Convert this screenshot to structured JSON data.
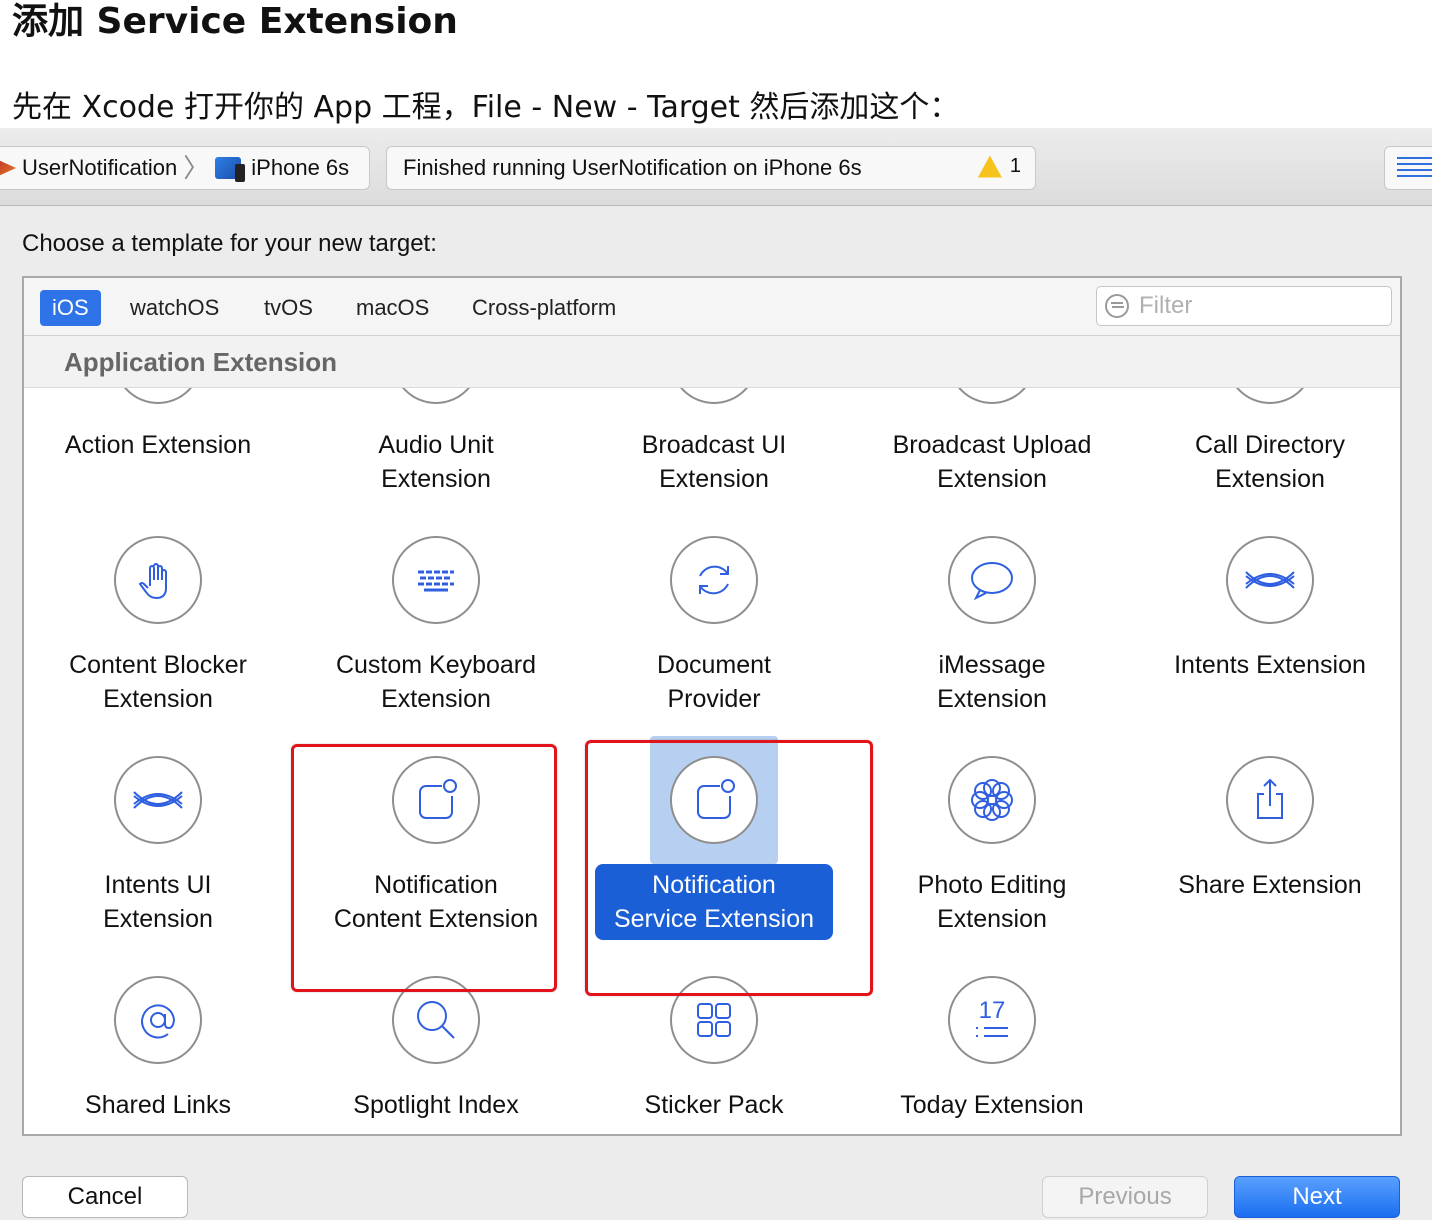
{
  "article": {
    "title": "添加 Service Extension",
    "subtitle": "先在 Xcode 打开你的 App 工程，File - New - Target 然后添加这个："
  },
  "toolbar": {
    "scheme_name": "UserNotification",
    "separator": "〉",
    "device_name": "iPhone 6s",
    "status_text": "Finished running UserNotification on iPhone 6s",
    "warning_count": "1"
  },
  "dialog": {
    "prompt": "Choose a template for your new target:",
    "tabs": [
      {
        "label": "iOS",
        "active": true
      },
      {
        "label": "watchOS",
        "active": false
      },
      {
        "label": "tvOS",
        "active": false
      },
      {
        "label": "macOS",
        "active": false
      },
      {
        "label": "Cross-platform",
        "active": false
      }
    ],
    "filter_placeholder": "Filter",
    "section_title": "Application Extension",
    "templates": [
      {
        "label": "Action Extension",
        "icon": "gear-icon"
      },
      {
        "label": "Audio Unit\nExtension",
        "icon": "audio-waves-icon"
      },
      {
        "label": "Broadcast UI\nExtension",
        "icon": "layers-icon"
      },
      {
        "label": "Broadcast Upload\nExtension",
        "icon": "layers-icon"
      },
      {
        "label": "Call Directory\nExtension",
        "icon": "phone-icon"
      },
      {
        "label": "Content Blocker\nExtension",
        "icon": "hand-icon"
      },
      {
        "label": "Custom Keyboard\nExtension",
        "icon": "keyboard-icon"
      },
      {
        "label": "Document\nProvider",
        "icon": "sync-icon"
      },
      {
        "label": "iMessage\nExtension",
        "icon": "speech-bubble-icon"
      },
      {
        "label": "Intents Extension",
        "icon": "intents-icon"
      },
      {
        "label": "Intents UI\nExtension",
        "icon": "intents-icon"
      },
      {
        "label": "Notification\nContent Extension",
        "icon": "notification-icon"
      },
      {
        "label": "Notification\nService Extension",
        "icon": "notification-icon",
        "selected": true
      },
      {
        "label": "Photo Editing\nExtension",
        "icon": "flower-icon"
      },
      {
        "label": "Share Extension",
        "icon": "share-icon"
      },
      {
        "label": "Shared Links",
        "icon": "at-sign-icon"
      },
      {
        "label": "Spotlight Index",
        "icon": "magnifier-icon"
      },
      {
        "label": "Sticker Pack",
        "icon": "grid-icon"
      },
      {
        "label": "Today Extension",
        "icon": "calendar-list-icon"
      }
    ],
    "today_icon_number": "17",
    "buttons": {
      "cancel": "Cancel",
      "previous": "Previous",
      "next": "Next"
    }
  },
  "colors": {
    "accent": "#1a5fd6",
    "icon_stroke": "#2f5fe0",
    "annotation_red": "#e0141a",
    "selection_bg": "#b7cff0"
  }
}
